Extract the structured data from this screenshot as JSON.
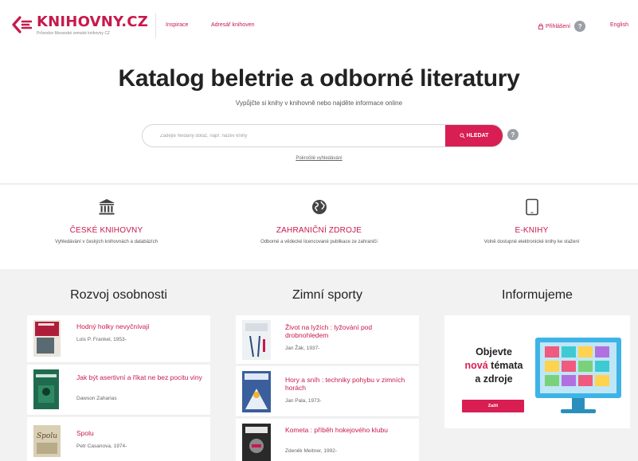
{
  "header": {
    "logo_title": "KNIHOVNY.CZ",
    "logo_subtitle": "Průvodce Moravské zemské knihovny CZ",
    "nav_inspirace": "Inspirace",
    "nav_adresar": "Adresář knihoven",
    "login_label": "Přihlášení",
    "help_glyph": "?",
    "language": "English"
  },
  "hero": {
    "title": "Katalog beletrie a odborné literatury",
    "subtitle": "Vypůjčte si knihy v knihovně nebo najděte informace online",
    "search_placeholder": "Zadejte hledaný dotaz, např. název knihy",
    "search_button": "HLEDAT",
    "advanced_search": "Pokročilé vyhledávání"
  },
  "features": [
    {
      "icon": "bank-icon",
      "title": "České knihovny",
      "desc": "Vyhledávání v českých knihovnách a databázích"
    },
    {
      "icon": "globe-icon",
      "title": "Zahraniční zdroje",
      "desc": "Odborné a vědecké licencované publikace ze zahraničí"
    },
    {
      "icon": "tablet-icon",
      "title": "E-knihy",
      "desc": "Volně dostupné elektronické knihy ke stažení"
    }
  ],
  "columns": {
    "col1_title": "Rozvoj osobnosti",
    "col2_title": "Zimní sporty",
    "col3_title": "Informujeme",
    "col1_books": [
      {
        "title": "Hodný holky nevyčnívají",
        "meta": "Lois P. Frankel, 1953-"
      },
      {
        "title": "Jak být asertivní a říkat ne bez pocitu viny",
        "meta": "Dawson Zaharias"
      },
      {
        "title": "Spolu",
        "meta": "Petr Casanova, 1974-"
      }
    ],
    "col2_books": [
      {
        "title": "Život na lyžích : lyžování pod drobnohledem",
        "meta": "Jan Žák, 1937-"
      },
      {
        "title": "Hory a sníh : techniky pohybu v zimních horách",
        "meta": "Jan Pala, 1973-"
      },
      {
        "title": "Kometa : příběh hokejového klubu",
        "meta": "Zdeněk Meitner, 1992-"
      }
    ]
  },
  "promo": {
    "line1": "Objevte",
    "accent": "nová",
    "line2_rest": " témata",
    "line3": "a zdroje",
    "button": "Zažít"
  },
  "colors": {
    "brand": "#c8194c",
    "accent": "#d81e52",
    "band": "#f2f2f2"
  }
}
